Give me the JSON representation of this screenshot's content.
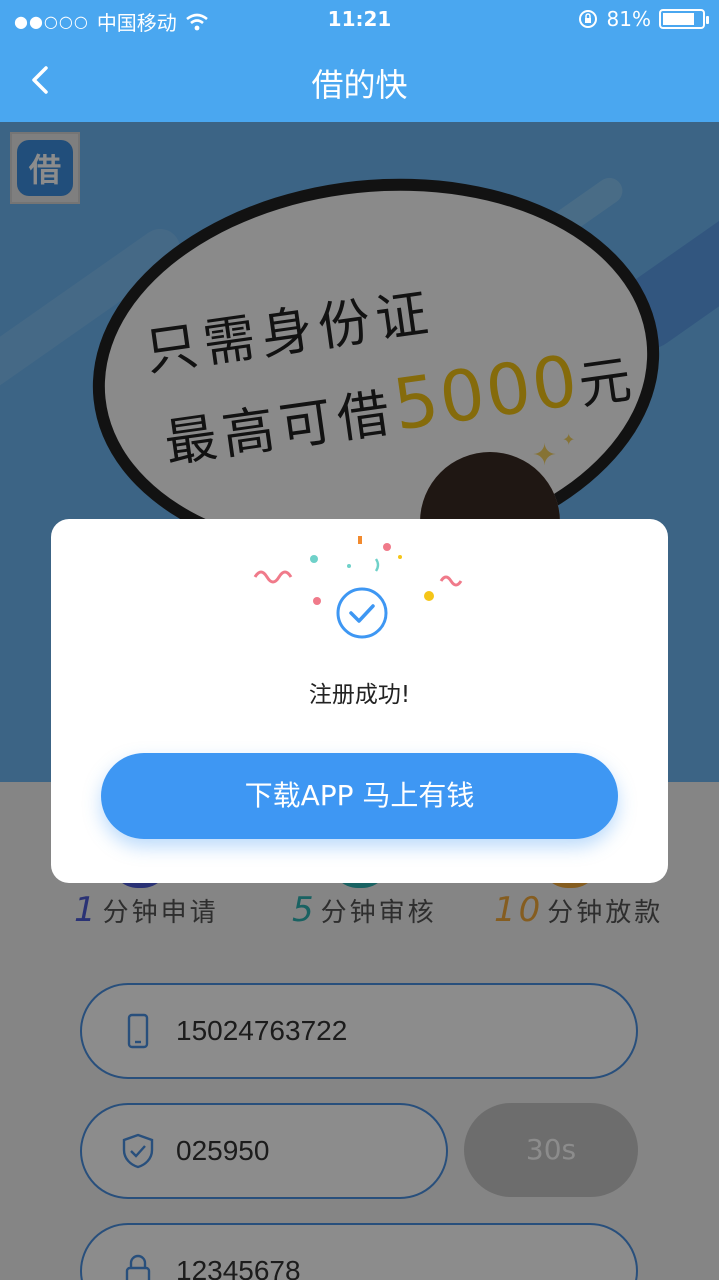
{
  "status_bar": {
    "signal": "●●○○○",
    "carrier": "中国移动",
    "time": "11:21",
    "battery_percent": "81%",
    "battery_level": 0.81
  },
  "nav": {
    "title": "借的快"
  },
  "banner": {
    "logo_text": "借",
    "slogan_line1": "只需身份证",
    "slogan_line2_prefix": "最高可借",
    "slogan_amount": "5000",
    "slogan_unit": "元"
  },
  "features": [
    {
      "num": "1",
      "label": "分钟申请",
      "color": "#4d5bd6"
    },
    {
      "num": "5",
      "label": "分钟审核",
      "color": "#2fb3b3"
    },
    {
      "num": "10",
      "label": "分钟放款",
      "color": "#f2a93b"
    }
  ],
  "form": {
    "phone": "15024763722",
    "code": "025950",
    "code_button": "30s",
    "password": "12345678"
  },
  "dialog": {
    "message": "注册成功!",
    "cta_label": "下载APP 马上有钱"
  },
  "colors": {
    "primary": "#4aa7f0",
    "button": "#3e97f3",
    "accent_gold": "#f2c314"
  }
}
